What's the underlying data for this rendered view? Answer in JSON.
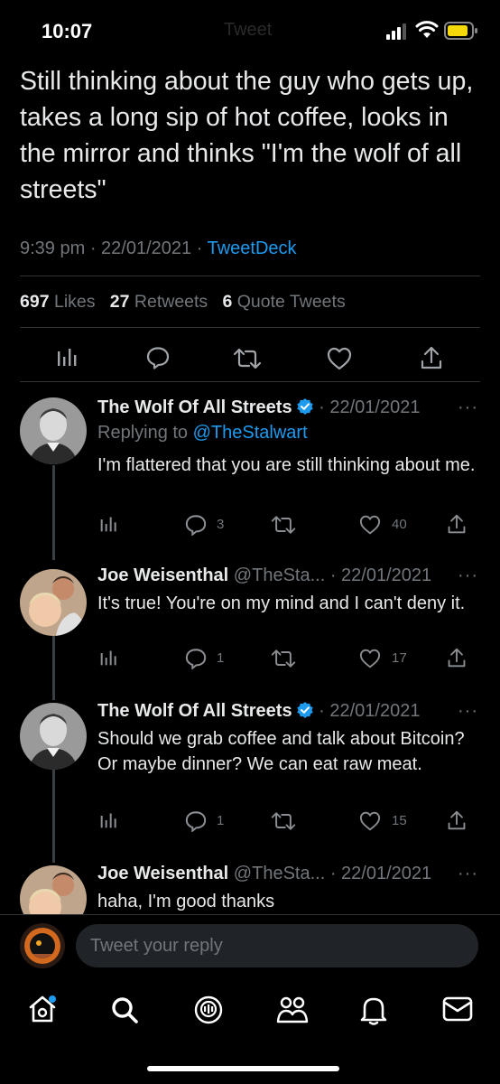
{
  "status_bar": {
    "time": "10:07",
    "ghost_title": "Tweet"
  },
  "main_tweet": {
    "text": "Still thinking about the guy who gets up, takes a long sip of hot coffee, looks in the mirror and thinks \"I'm the wolf of all streets\"",
    "time": "9:39 pm",
    "date": "22/01/2021",
    "source": "TweetDeck",
    "likes_count": "697",
    "likes_label": "Likes",
    "retweets_count": "27",
    "retweets_label": "Retweets",
    "quotes_count": "6",
    "quotes_label": "Quote Tweets"
  },
  "replies": [
    {
      "name": "The Wolf Of All Streets",
      "handle": "",
      "date": "· 22/01/2021",
      "replying_prefix": "Replying to ",
      "replying_to": "@TheStalwart",
      "text": "I'm flattered that you are still thinking about me.",
      "replies": "3",
      "retweets": "",
      "likes": "40"
    },
    {
      "name": "Joe Weisenthal",
      "handle": "@TheSta...",
      "date": "· 22/01/2021",
      "text": "It's true! You're on my mind and I can't deny it.",
      "replies": "1",
      "retweets": "",
      "likes": "17"
    },
    {
      "name": "The Wolf Of All Streets",
      "handle": "",
      "date": "· 22/01/2021",
      "text": "Should we grab coffee and talk about Bitcoin? Or maybe dinner? We can eat raw meat.",
      "replies": "1",
      "retweets": "",
      "likes": "15"
    },
    {
      "name": "Joe Weisenthal",
      "handle": "@TheSta...",
      "date": "· 22/01/2021",
      "text": "haha, I'm good thanks"
    }
  ],
  "more_glyph": "···",
  "compose": {
    "placeholder": "Tweet your reply"
  },
  "colors": {
    "accent": "#1d9bf0",
    "background": "#000000",
    "muted": "#71767b"
  },
  "tab_icons": [
    "home-icon",
    "search-icon",
    "spaces-icon",
    "communities-icon",
    "notifications-icon",
    "messages-icon"
  ]
}
